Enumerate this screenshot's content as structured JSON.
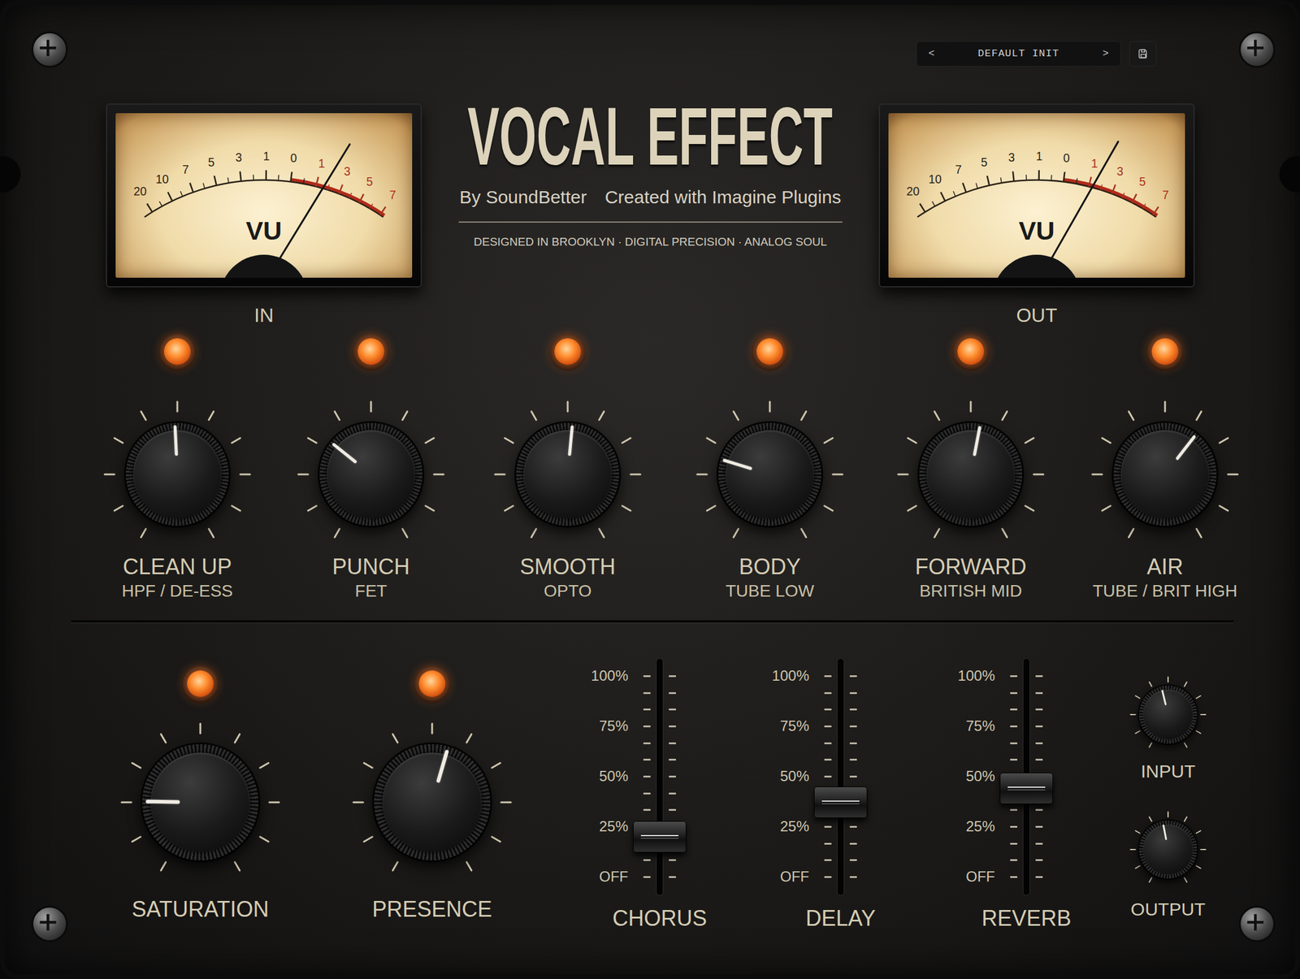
{
  "preset": {
    "prev": "<",
    "name": "DEFAULT INIT",
    "next": ">"
  },
  "title": "VOCAL EFFECT",
  "byline": "By SoundBetter",
  "credit": "Created with Imagine Plugins",
  "tagline": "DESIGNED IN BROOKLYN · DIGITAL PRECISION · ANALOG SOUL",
  "meters": [
    {
      "label": "IN",
      "unit": "VU",
      "level": 0.85,
      "marks": [
        {
          "text": "20",
          "color": "#2b2418"
        },
        {
          "text": "10",
          "color": "#2b2418"
        },
        {
          "text": "7",
          "color": "#2b2418"
        },
        {
          "text": "5",
          "color": "#2b2418"
        },
        {
          "text": "3",
          "color": "#2b2418"
        },
        {
          "text": "1",
          "color": "#2b2418"
        },
        {
          "text": "0",
          "color": "#2b2418"
        },
        {
          "text": "1",
          "color": "#a8321e"
        },
        {
          "text": "3",
          "color": "#a8321e"
        },
        {
          "text": "5",
          "color": "#a8321e"
        },
        {
          "text": "7",
          "color": "#a8321e"
        }
      ]
    },
    {
      "label": "OUT",
      "unit": "VU",
      "level": 0.83,
      "marks": [
        {
          "text": "20",
          "color": "#2b2418"
        },
        {
          "text": "10",
          "color": "#2b2418"
        },
        {
          "text": "7",
          "color": "#2b2418"
        },
        {
          "text": "5",
          "color": "#2b2418"
        },
        {
          "text": "3",
          "color": "#2b2418"
        },
        {
          "text": "1",
          "color": "#2b2418"
        },
        {
          "text": "0",
          "color": "#2b2418"
        },
        {
          "text": "1",
          "color": "#a8321e"
        },
        {
          "text": "3",
          "color": "#a8321e"
        },
        {
          "text": "5",
          "color": "#a8321e"
        },
        {
          "text": "7",
          "color": "#a8321e"
        }
      ]
    }
  ],
  "knobs": [
    {
      "name": "CLEAN UP",
      "sub": "HPF / DE-ESS",
      "level": 0.49,
      "led_on": true
    },
    {
      "name": "PUNCH",
      "sub": "FET",
      "level": 0.31,
      "led_on": true
    },
    {
      "name": "SMOOTH",
      "sub": "OPTO",
      "level": 0.52,
      "led_on": true
    },
    {
      "name": "BODY",
      "sub": "TUBE LOW",
      "level": 0.23,
      "led_on": true
    },
    {
      "name": "FORWARD",
      "sub": "BRITISH MID",
      "level": 0.54,
      "led_on": true
    },
    {
      "name": "AIR",
      "sub": "TUBE / BRIT HIGH",
      "level": 0.64,
      "led_on": true
    }
  ],
  "bottom_knobs": [
    {
      "name": "SATURATION",
      "level": 0.17,
      "led_on": true
    },
    {
      "name": "PRESENCE",
      "level": 0.56,
      "led_on": true
    }
  ],
  "faders": [
    {
      "name": "CHORUS",
      "level": 0.2,
      "scale": [
        "100%",
        "75%",
        "50%",
        "25%",
        "OFF"
      ]
    },
    {
      "name": "DELAY",
      "level": 0.37,
      "scale": [
        "100%",
        "75%",
        "50%",
        "25%",
        "OFF"
      ]
    },
    {
      "name": "REVERB",
      "level": 0.44,
      "scale": [
        "100%",
        "75%",
        "50%",
        "25%",
        "OFF"
      ]
    }
  ],
  "trims": [
    {
      "name": "INPUT",
      "level": 0.45
    },
    {
      "name": "OUTPUT",
      "level": 0.46
    }
  ]
}
